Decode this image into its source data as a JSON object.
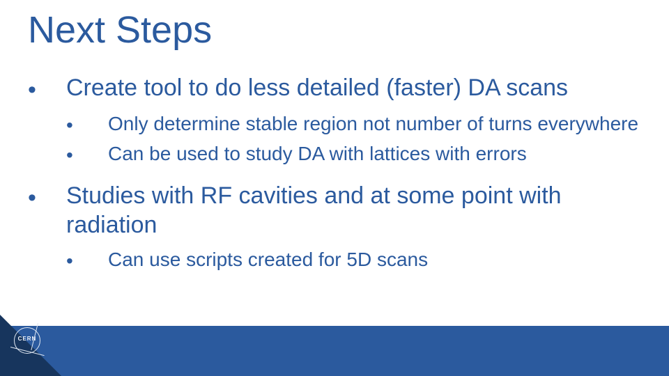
{
  "title": "Next Steps",
  "items": [
    {
      "text": "Create tool to do less detailed (faster) DA scans",
      "sub": [
        "Only determine stable region not number of turns everywhere",
        "Can be used to study DA with lattices with errors"
      ]
    },
    {
      "text": "Studies with RF cavities and at some point with radiation",
      "sub": [
        "Can use scripts created for 5D scans"
      ]
    }
  ],
  "logo_label": "CERN"
}
